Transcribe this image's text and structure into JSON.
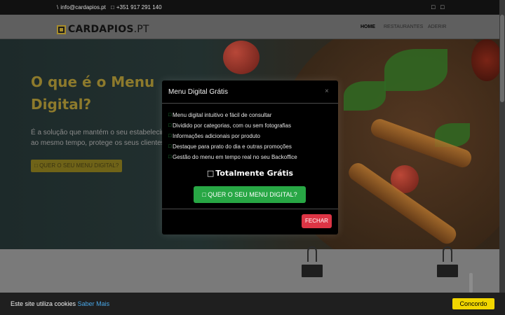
{
  "topbar": {
    "email": "info@cardapios.pt",
    "phone": "+351 917 291 140",
    "email_icon": "envelope-icon",
    "phone_icon": "phone-icon",
    "social_icons": [
      "facebook-icon",
      "instagram-icon"
    ]
  },
  "brand": {
    "name": "CARDAPIOS",
    "tld": ".PT"
  },
  "nav": {
    "items": [
      "HOME",
      "RESTAURANTES",
      "ADERIR"
    ],
    "active": "HOME"
  },
  "hero": {
    "title": "O que é o Menu Digital?",
    "text_line1": "É a solução que mantém o seu estabelecimento",
    "text_line2": "ao mesmo tempo, protege os seus clientes",
    "button_icon": "□",
    "button_label": "QUER O SEU MENU DIGITAL?"
  },
  "modal": {
    "title": "Menu Digital Grátis",
    "close_glyph": "×",
    "check_glyph": "□",
    "features": [
      "Menu digital intuitivo e fácil de consultar",
      "Dividido por categorias, com ou sem fotografias",
      "Informações adicionais por produto",
      "Destaque para prato do dia e outras promoções",
      "Gestão do menu em tempo real no seu Backoffice"
    ],
    "free_icon": "□",
    "free_label": "Totalmente Grátis",
    "cta_icon": "□",
    "cta_label": "QUER O SEU MENU DIGITAL?",
    "close_button": "FECHAR"
  },
  "cookie": {
    "text": "Este site utiliza cookies",
    "link": "Saber Mais",
    "button": "Concordo"
  },
  "colors": {
    "accent_gold": "#c9a227",
    "cta_green": "#28a745",
    "close_red": "#dc3545",
    "cookie_yellow": "#f1d600",
    "link_blue": "#49a6e6"
  }
}
